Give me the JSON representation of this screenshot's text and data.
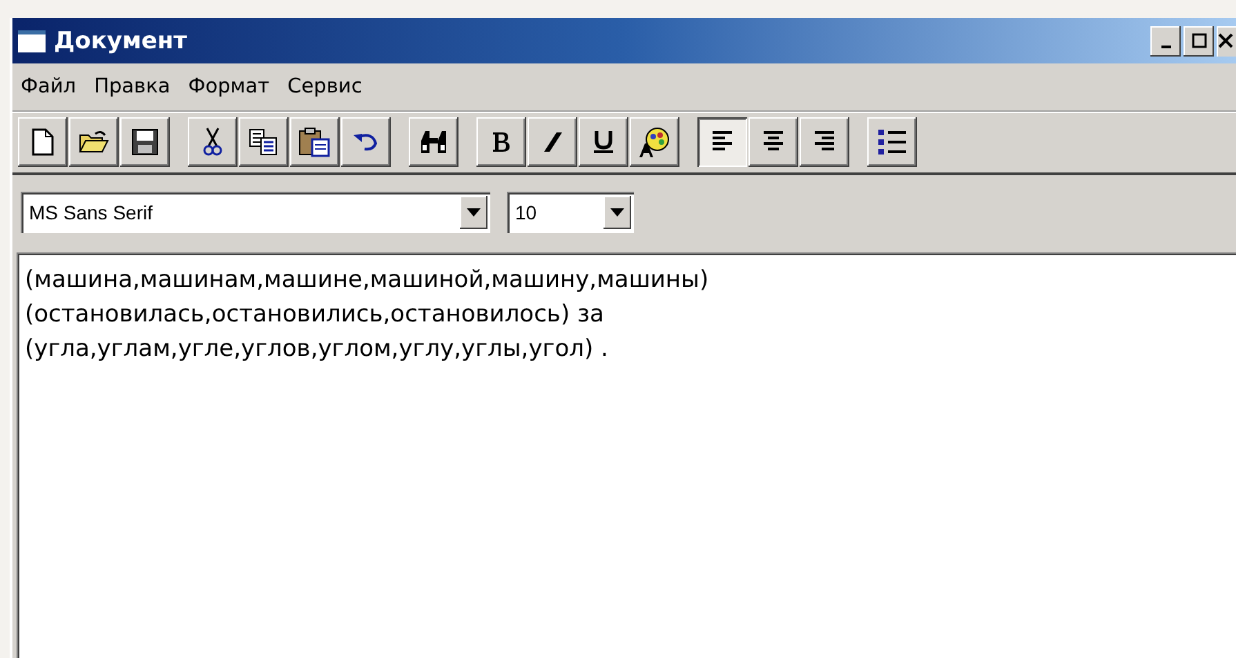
{
  "window": {
    "title": "Документ"
  },
  "menu": [
    "Файл",
    "Правка",
    "Формат",
    "Сервис"
  ],
  "toolbar": [
    {
      "kind": "new"
    },
    {
      "kind": "open"
    },
    {
      "kind": "save"
    },
    {
      "kind": "sep"
    },
    {
      "kind": "cut"
    },
    {
      "kind": "copy"
    },
    {
      "kind": "paste"
    },
    {
      "kind": "undo"
    },
    {
      "kind": "sep"
    },
    {
      "kind": "find"
    },
    {
      "kind": "sep"
    },
    {
      "kind": "bold"
    },
    {
      "kind": "italic"
    },
    {
      "kind": "underline"
    },
    {
      "kind": "color"
    }
  ],
  "alignment": [
    {
      "kind": "left",
      "selected": true
    },
    {
      "kind": "center",
      "selected": false
    },
    {
      "kind": "right",
      "selected": false
    }
  ],
  "bullets": {
    "selected": false
  },
  "font": {
    "value": "MS Sans Serif"
  },
  "size": {
    "value": "10"
  },
  "document": {
    "lines": [
      "(машина,машинам,машине,машиной,машину,машины)",
      "(остановилась,остановились,остановилось) за",
      "(угла,углам,угле,углов,углом,углу,углы,угол) ."
    ]
  }
}
